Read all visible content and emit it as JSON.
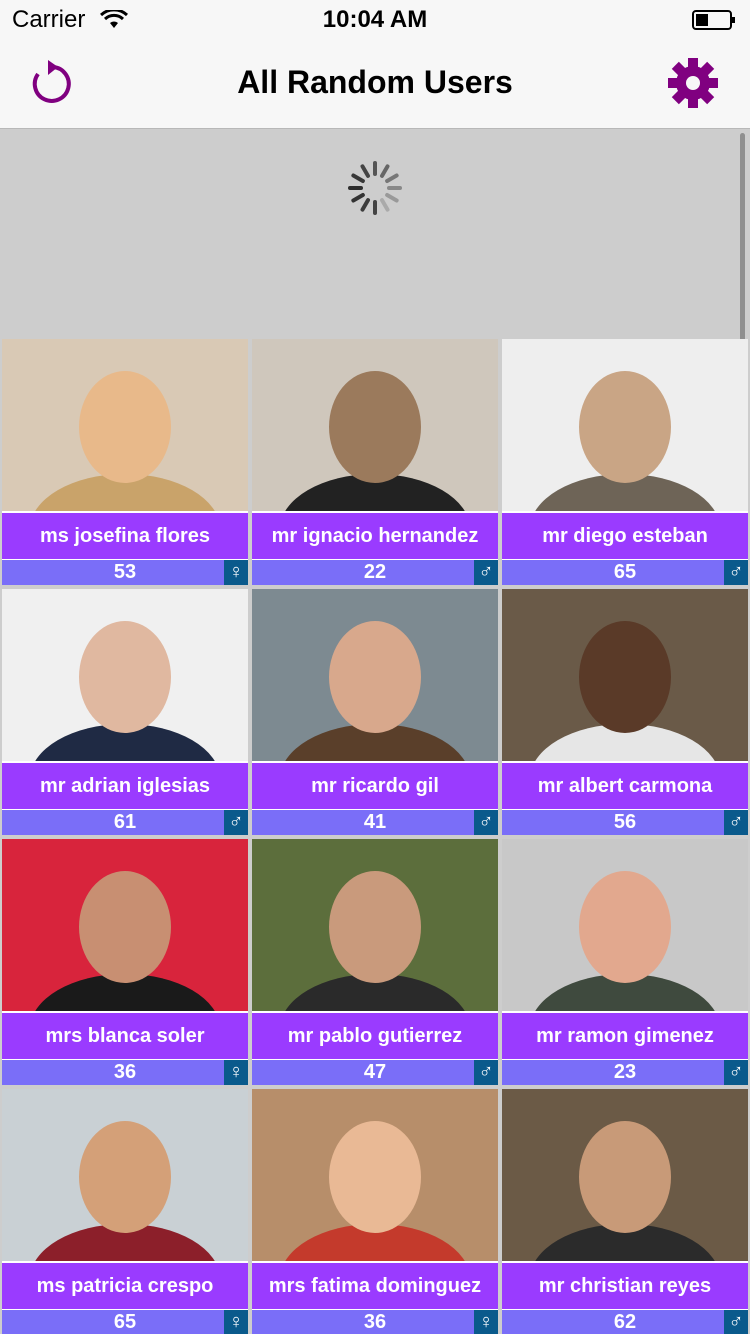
{
  "status_bar": {
    "carrier": "Carrier",
    "time": "10:04 AM"
  },
  "nav": {
    "title": "All Random Users",
    "refresh_icon": "refresh-icon",
    "settings_icon": "gear-icon"
  },
  "colors": {
    "accent": "#800080",
    "name_bar": "#9a3bff",
    "age_bar": "#7a6ef8",
    "gender_badge": "#0a5a8c",
    "background": "#cdcdcd"
  },
  "users": [
    {
      "name": "ms josefina flores",
      "age": "53",
      "gender_symbol": "♀",
      "gender": "female"
    },
    {
      "name": "mr ignacio hernandez",
      "age": "22",
      "gender_symbol": "♂",
      "gender": "male"
    },
    {
      "name": "mr diego esteban",
      "age": "65",
      "gender_symbol": "♂",
      "gender": "male"
    },
    {
      "name": "mr adrian iglesias",
      "age": "61",
      "gender_symbol": "♂",
      "gender": "male"
    },
    {
      "name": "mr ricardo gil",
      "age": "41",
      "gender_symbol": "♂",
      "gender": "male"
    },
    {
      "name": "mr albert carmona",
      "age": "56",
      "gender_symbol": "♂",
      "gender": "male"
    },
    {
      "name": "mrs blanca soler",
      "age": "36",
      "gender_symbol": "♀",
      "gender": "female"
    },
    {
      "name": "mr pablo gutierrez",
      "age": "47",
      "gender_symbol": "♂",
      "gender": "male"
    },
    {
      "name": "mr ramon gimenez",
      "age": "23",
      "gender_symbol": "♂",
      "gender": "male"
    },
    {
      "name": "ms patricia crespo",
      "age": "65",
      "gender_symbol": "♀",
      "gender": "female"
    },
    {
      "name": "mrs fatima dominguez",
      "age": "36",
      "gender_symbol": "♀",
      "gender": "female"
    },
    {
      "name": "mr christian reyes",
      "age": "62",
      "gender_symbol": "♂",
      "gender": "male"
    }
  ]
}
